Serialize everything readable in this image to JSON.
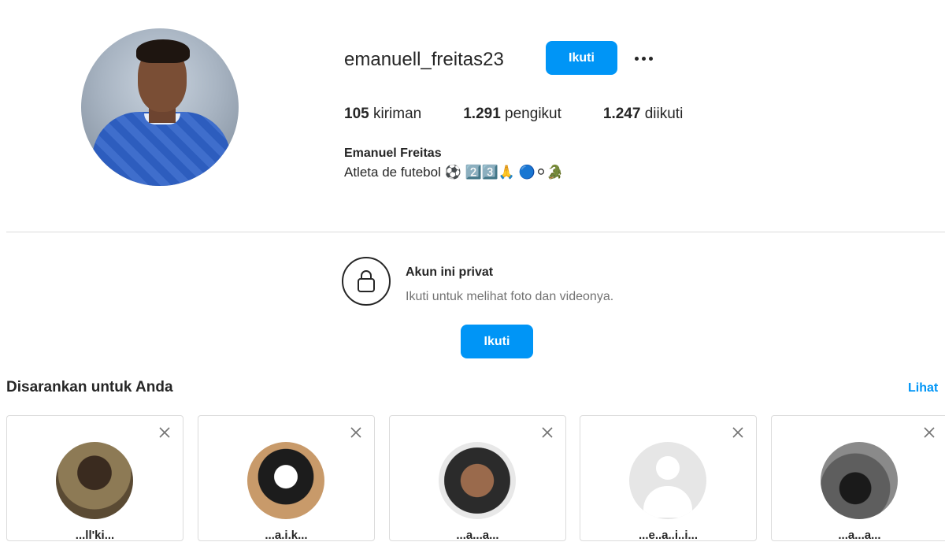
{
  "profile": {
    "username": "emanuell_freitas23",
    "follow_label": "Ikuti",
    "posts_count": "105",
    "posts_label": "kiriman",
    "followers_count": "1.291",
    "followers_label": "pengikut",
    "following_count": "1.247",
    "following_label": "diikuti",
    "full_name": "Emanuel Freitas",
    "bio": "Atleta de futebol ⚽ 2️⃣3️⃣🙏 🔵⚪🐊"
  },
  "private": {
    "title": "Akun ini privat",
    "subtitle": "Ikuti untuk melihat foto dan videonya.",
    "follow_label": "Ikuti"
  },
  "suggestions": {
    "title": "Disarankan untuk Anda",
    "see_all": "Lihat",
    "cards": [
      {
        "name": "...ll'ki..."
      },
      {
        "name": "...a.i.k..."
      },
      {
        "name": "...a...a..."
      },
      {
        "name": "...e..a..i..i..."
      },
      {
        "name": "...a...a..."
      }
    ]
  },
  "colors": {
    "accent": "#0095f6",
    "text": "#262626",
    "secondary_text": "#737373",
    "border": "#dbdbdb"
  },
  "icons": [
    "more-icon",
    "lock-icon",
    "close-icon"
  ]
}
